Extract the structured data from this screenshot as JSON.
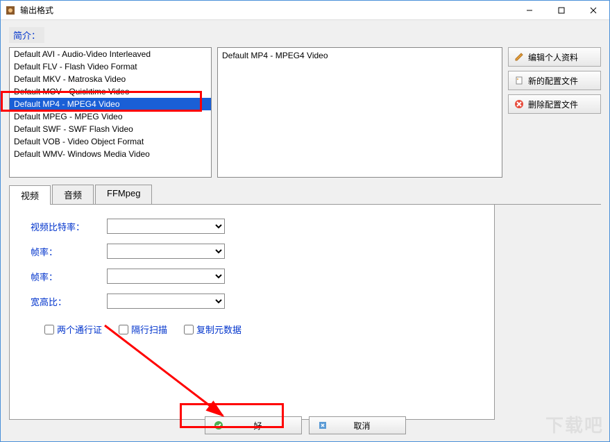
{
  "window": {
    "title": "输出格式"
  },
  "section": {
    "brief": "简介："
  },
  "formatList": {
    "items": [
      "Default AVI - Audio-Video Interleaved",
      "Default FLV - Flash Video Format",
      "Default MKV - Matroska Video",
      "Default MOV - Quicktime Video",
      "Default MP4 - MPEG4 Video",
      "Default MPEG - MPEG Video",
      "Default SWF - SWF Flash Video",
      "Default VOB - Video Object Format",
      "Default WMV- Windows Media Video"
    ],
    "selectedIndex": 4
  },
  "detail": {
    "text": "Default MP4 - MPEG4 Video"
  },
  "sideButtons": {
    "editProfile": "编辑个人资料",
    "newProfile": "新的配置文件",
    "deleteProfile": "删除配置文件"
  },
  "tabs": {
    "video": "视频",
    "audio": "音频",
    "ffmpeg": "FFMpeg",
    "active": "video"
  },
  "form": {
    "videoBitrate": {
      "label": "视频比特率：",
      "value": ""
    },
    "framerate1": {
      "label": "帧率：",
      "value": ""
    },
    "framerate2": {
      "label": "帧率：",
      "value": ""
    },
    "aspectRatio": {
      "label": "宽高比：",
      "value": ""
    }
  },
  "checkboxes": {
    "twoPass": "两个通行证",
    "interlace": "隔行扫描",
    "copyMeta": "复制元数据"
  },
  "buttons": {
    "ok": "好",
    "cancel": "取消"
  },
  "watermark": "下载吧"
}
